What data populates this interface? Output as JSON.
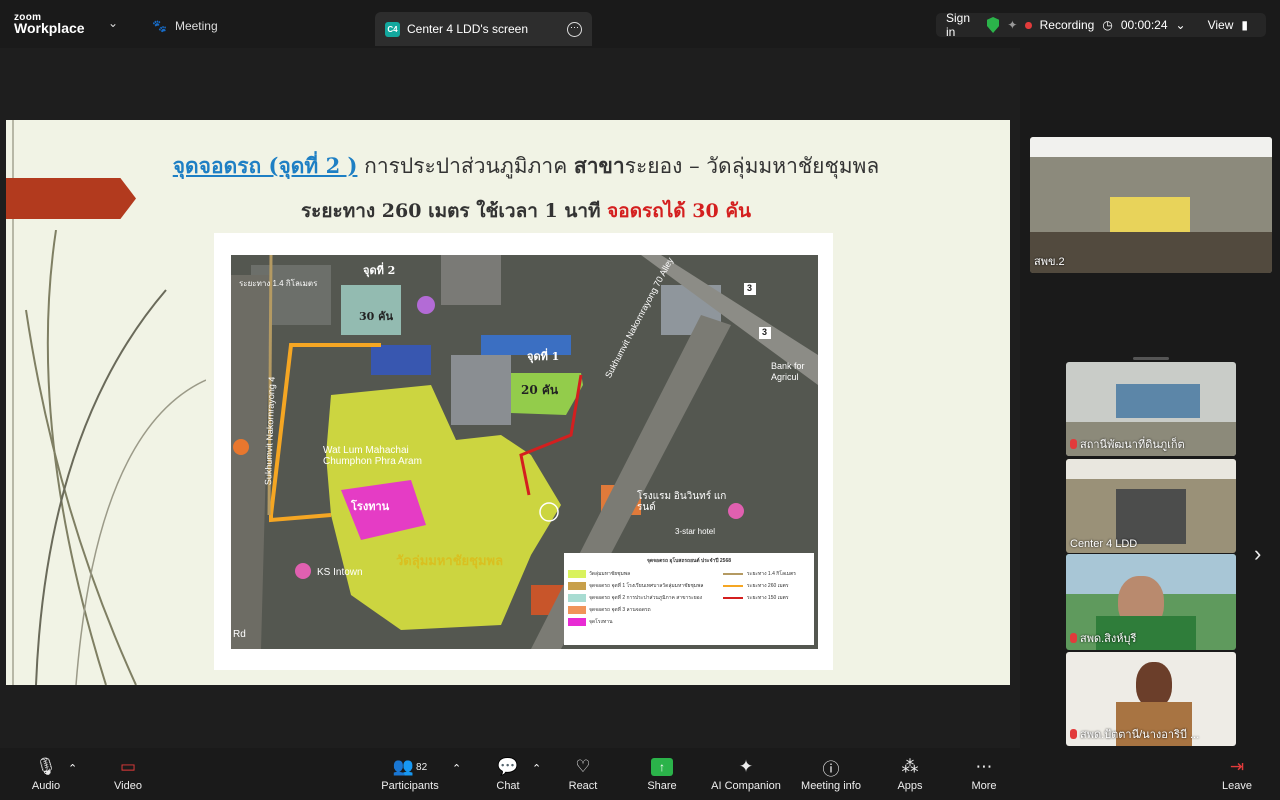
{
  "app": {
    "logo_small": "zoom",
    "logo_big": "Workplace"
  },
  "topbar": {
    "meeting_label": "Meeting",
    "tab_badge": "C4",
    "tab_label": "Center 4 LDD's screen",
    "sign_in": "Sign in",
    "recording": "Recording",
    "timer": "00:00:24",
    "view": "View"
  },
  "slide": {
    "title_underlined": "จุดจอดรถ (จุดที่ 2 )",
    "title_rest1": " การประปาส่วนภูมิภาค ",
    "title_bold": "สาขา",
    "title_rest2": "ระยอง – วัดลุ่มมหาชัยชุมพล",
    "subtitle_black": "ระยะทาง 260 เมตร ใช้เวลา 1 นาที ",
    "subtitle_red": "จอดรถได้ 30 คัน"
  },
  "map": {
    "spot2": "จุดที่ 2",
    "cars30": "30 คัน",
    "spot1": "จุดที่ 1",
    "cars20": "20 คัน",
    "temple_en": "Wat Lum Mahachai Chumphon Phra Aram",
    "school": "โรงทาน",
    "temple_th": "วัดลุ่มมหาชัยชุมพล",
    "hotel_th": "โรงแรม อินวินทร์ แกรนด์",
    "hotel_en": "3-star hotel",
    "ks": "KS Intown",
    "street": "Sukhumvit Nakornrayong 70 Alley",
    "bank": "Bank for Agricul",
    "road_left": "Sukhumvit Nakornrayong 4",
    "rd": "Rd",
    "distance_label": "ระยะทาง 1.4 กิโลเมตร",
    "sign3": "3",
    "legend_title": "จุดจอดรถ อุโบสถรถยนต์ ประจำปี 2568",
    "legend_items": [
      "วัดลุ่มมหาชัยชุมพล",
      "จุดจอดรถ จุดที่ 1 โรงเรียนเทศบาลวัดลุ่มมหาชัยชุมพล",
      "จุดจอดรถ จุดที่ 2 การประปาส่วนภูมิภาค สาขาระยอง",
      "จุดจอดรถ จุดที่ 3 ลานจอดรถ",
      "จุดโรงทาน"
    ],
    "legend_lines": [
      "ระยะทาง 1.4 กิโลเมตร",
      "ระยะทาง 260 เมตร",
      "ระยะทาง 150 เมตร"
    ],
    "legend_colors": [
      "#d9f25e",
      "#c8a04a",
      "#a8dcd2",
      "#f0945a",
      "#e82bd4"
    ],
    "line_colors": [
      "#b49a62",
      "#f5a623",
      "#d41f1f"
    ]
  },
  "participants": [
    {
      "name": "สพข.2"
    },
    {
      "name": "สถานีพัฒนาที่ดินภูเก็ต"
    },
    {
      "name": "Center 4 LDD"
    },
    {
      "name": "สพด.สิงห์บุรี"
    },
    {
      "name": "สพด.ปัตตานี/นางอาริบี ..."
    }
  ],
  "toolbar": {
    "audio": "Audio",
    "video": "Video",
    "participants": "Participants",
    "participants_count": "82",
    "chat": "Chat",
    "react": "React",
    "share": "Share",
    "ai": "AI Companion",
    "info": "Meeting info",
    "apps": "Apps",
    "more": "More",
    "leave": "Leave"
  },
  "colors": {
    "accent": "#2bb34a",
    "record": "#e23b3b",
    "tab_badge": "#13a89e",
    "banner": "#b23a1e"
  }
}
